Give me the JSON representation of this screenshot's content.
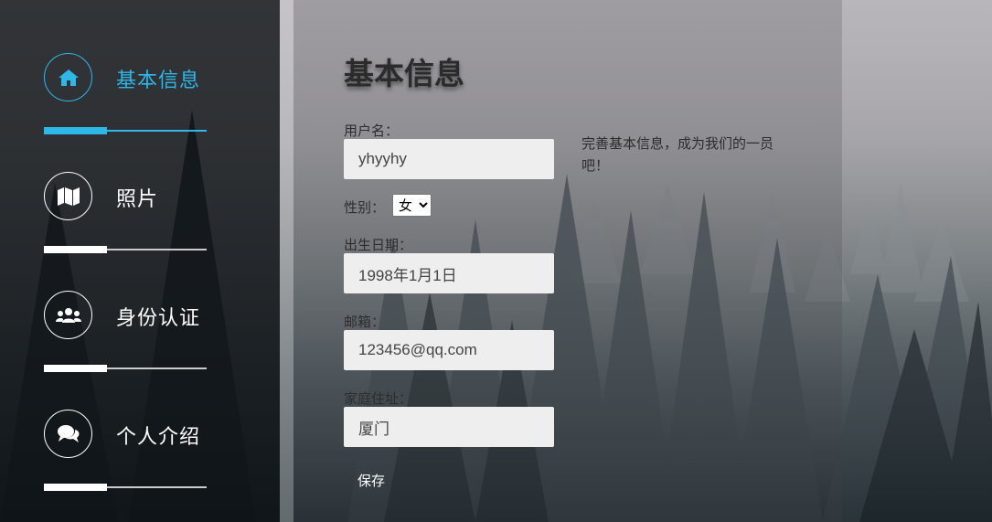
{
  "sidebar": {
    "items": [
      {
        "label": "基本信息",
        "icon": "home-icon",
        "active": true
      },
      {
        "label": "照片",
        "icon": "map-icon",
        "active": false
      },
      {
        "label": "身份认证",
        "icon": "users-icon",
        "active": false
      },
      {
        "label": "个人介绍",
        "icon": "comments-icon",
        "active": false
      }
    ]
  },
  "form": {
    "title": "基本信息",
    "username_label": "用户名：",
    "username_value": "yhyyhy",
    "gender_label": "性别：",
    "gender_value": "女",
    "birthday_label": "出生日期：",
    "birthday_value": "1998年1月1日",
    "email_label": "邮箱：",
    "email_value": "123456@qq.com",
    "address_label": "家庭住址：",
    "address_value": "厦门",
    "save_label": "保存"
  },
  "hint": "完善基本信息，成为我们的一员吧！",
  "colors": {
    "accent": "#2fb7e8",
    "input_bg": "#eeeeee",
    "sidebar_bg": "#0c1013"
  }
}
